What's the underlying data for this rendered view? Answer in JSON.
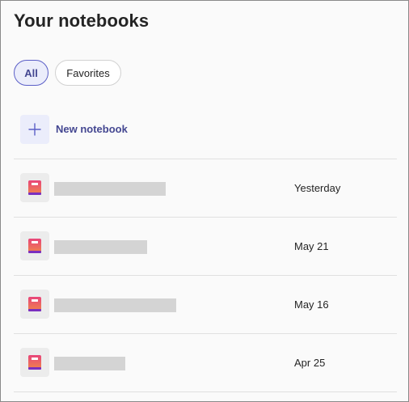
{
  "header": {
    "title": "Your notebooks"
  },
  "filters": {
    "all_label": "All",
    "favorites_label": "Favorites"
  },
  "new_notebook": {
    "label": "New notebook",
    "icon": "plus-icon"
  },
  "notebooks": [
    {
      "icon": "notebook-icon",
      "date": "Yesterday"
    },
    {
      "icon": "notebook-icon",
      "date": "May 21"
    },
    {
      "icon": "notebook-icon",
      "date": "May 16"
    },
    {
      "icon": "notebook-icon",
      "date": "Apr 25"
    }
  ],
  "colors": {
    "accent": "#5b5fc7",
    "accent_text": "#444791",
    "accent_bg": "#ebedfb",
    "notebook_icon_top": "#e8457a",
    "notebook_icon_bottom": "#f0864a"
  }
}
